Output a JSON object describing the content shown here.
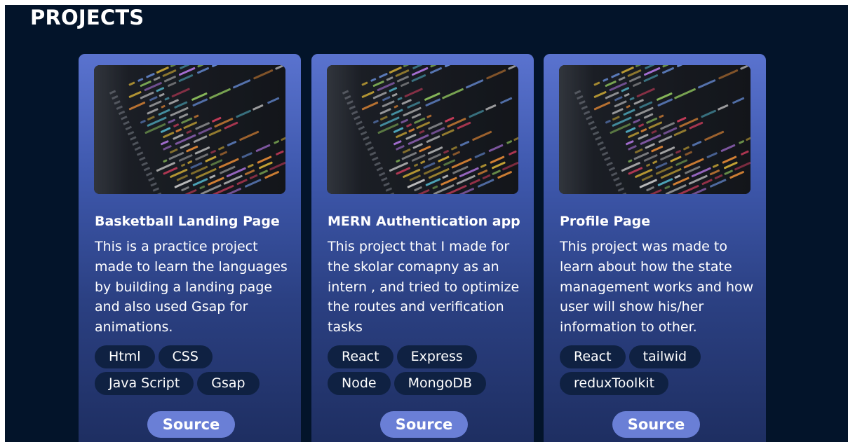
{
  "page": {
    "title": "PROJECTS"
  },
  "projects": [
    {
      "title": "Basketball Landing Page",
      "description": "This is a practice project made to learn the languages by building a landing page and also used Gsap for animations.",
      "tags": [
        "Html",
        "CSS",
        "Java Script",
        "Gsap"
      ],
      "source_label": "Source"
    },
    {
      "title": "MERN Authentication app",
      "description": "This project that I made for the skolar comapny as an intern , and tried to optimize the routes and verification tasks",
      "tags": [
        "React",
        "Express",
        "Node",
        "MongoDB"
      ],
      "source_label": "Source"
    },
    {
      "title": "Profile Page",
      "description": "This project was made to learn about how the state management works and how user will show his/her information to other.",
      "tags": [
        "React",
        "tailwid",
        "reduxToolkit"
      ],
      "source_label": "Source"
    }
  ],
  "theme": {
    "background": "#03142a",
    "card_top": "#5a73cf",
    "card_bottom": "#1d2d5f",
    "tag_bg": "#0f2142",
    "button_bg": "#6a7fd6",
    "text": "#ffffff"
  }
}
